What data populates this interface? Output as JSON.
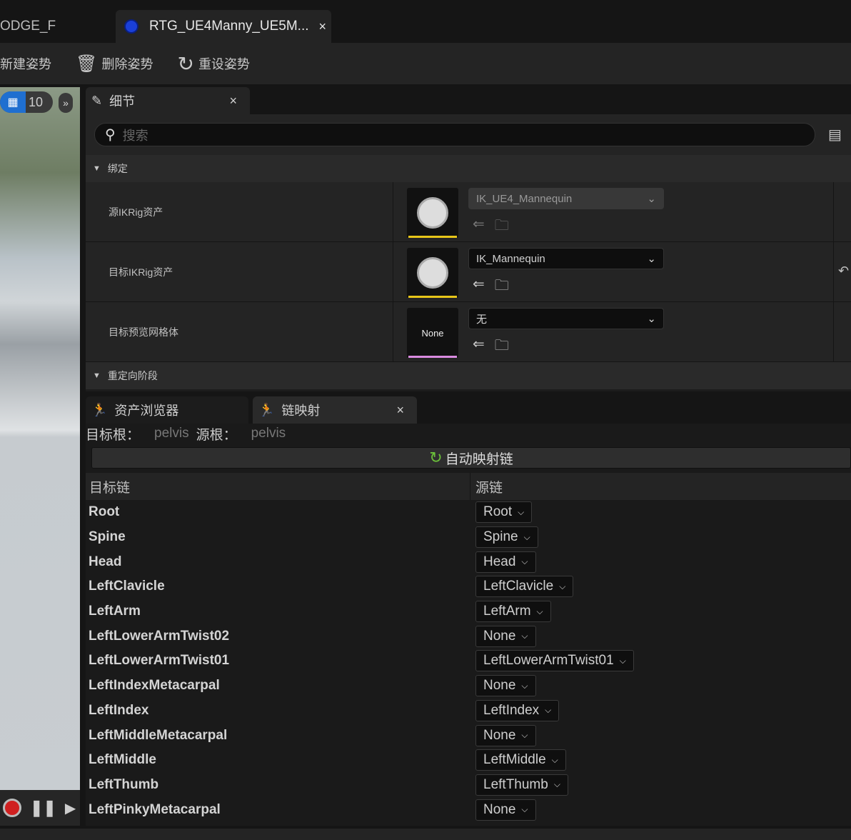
{
  "tabs": [
    {
      "label": "ODGE_F"
    },
    {
      "label": "RTG_UE4Manny_UE5M...",
      "close": "×"
    }
  ],
  "toolbar": {
    "new_pose": "新建姿势",
    "delete_pose": "删除姿势",
    "reset_pose": "重设姿势"
  },
  "viewport": {
    "grid_value": "10"
  },
  "details": {
    "tab_label": "细节",
    "close": "×",
    "search_placeholder": "搜索",
    "section_binding": "绑定",
    "section_retarget": "重定向阶段",
    "props": [
      {
        "label": "源IKRig资产",
        "value": "IK_UE4_Mannequin",
        "thumb": "",
        "bar_color": "#e8c619"
      },
      {
        "label": "目标IKRig资产",
        "value": "IK_Mannequin",
        "thumb": "",
        "bar_color": "#e8c619"
      },
      {
        "label": "目标预览网格体",
        "value": "无",
        "thumb": "None",
        "bar_color": "#d98be0"
      }
    ]
  },
  "bottom_tabs": {
    "asset_browser": "资产浏览器",
    "chain_mapping": "链映射",
    "close": "×"
  },
  "chain_mapping": {
    "target_root_label": "目标根：",
    "target_root": "pelvis",
    "source_root_label": "源根：",
    "source_root": "pelvis",
    "auto_map": "自动映射链",
    "col_target": "目标链",
    "col_source": "源链",
    "rows": [
      {
        "target": "Root",
        "source": "Root"
      },
      {
        "target": "Spine",
        "source": "Spine"
      },
      {
        "target": "Head",
        "source": "Head"
      },
      {
        "target": "LeftClavicle",
        "source": "LeftClavicle"
      },
      {
        "target": "LeftArm",
        "source": "LeftArm"
      },
      {
        "target": "LeftLowerArmTwist02",
        "source": "None"
      },
      {
        "target": "LeftLowerArmTwist01",
        "source": "LeftLowerArmTwist01"
      },
      {
        "target": "LeftIndexMetacarpal",
        "source": "None"
      },
      {
        "target": "LeftIndex",
        "source": "LeftIndex"
      },
      {
        "target": "LeftMiddleMetacarpal",
        "source": "None"
      },
      {
        "target": "LeftMiddle",
        "source": "LeftMiddle"
      },
      {
        "target": "LeftThumb",
        "source": "LeftThumb"
      },
      {
        "target": "LeftPinkyMetacarpal",
        "source": "None"
      }
    ]
  }
}
